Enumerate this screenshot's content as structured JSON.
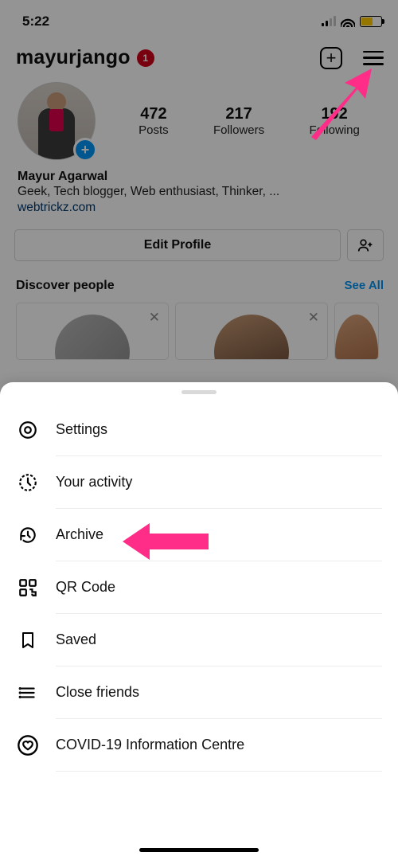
{
  "status_bar": {
    "time": "5:22"
  },
  "header": {
    "username": "mayurjango",
    "notification_count": "1"
  },
  "stats": {
    "posts": {
      "count": "472",
      "label": "Posts"
    },
    "followers": {
      "count": "217",
      "label": "Followers"
    },
    "following": {
      "count": "192",
      "label": "Following"
    }
  },
  "bio": {
    "name": "Mayur Agarwal",
    "description": "Geek, Tech blogger, Web enthusiast, Thinker, ...",
    "link": "webtrickz.com"
  },
  "actions": {
    "edit_profile": "Edit Profile"
  },
  "discover": {
    "title": "Discover people",
    "see_all": "See All"
  },
  "menu": {
    "items": [
      {
        "id": "settings",
        "label": "Settings"
      },
      {
        "id": "your-activity",
        "label": "Your activity"
      },
      {
        "id": "archive",
        "label": "Archive"
      },
      {
        "id": "qr-code",
        "label": "QR Code"
      },
      {
        "id": "saved",
        "label": "Saved"
      },
      {
        "id": "close-friends",
        "label": "Close friends"
      },
      {
        "id": "covid",
        "label": "COVID-19 Information Centre"
      }
    ]
  },
  "annotation": {
    "color": "#ff2d87"
  }
}
